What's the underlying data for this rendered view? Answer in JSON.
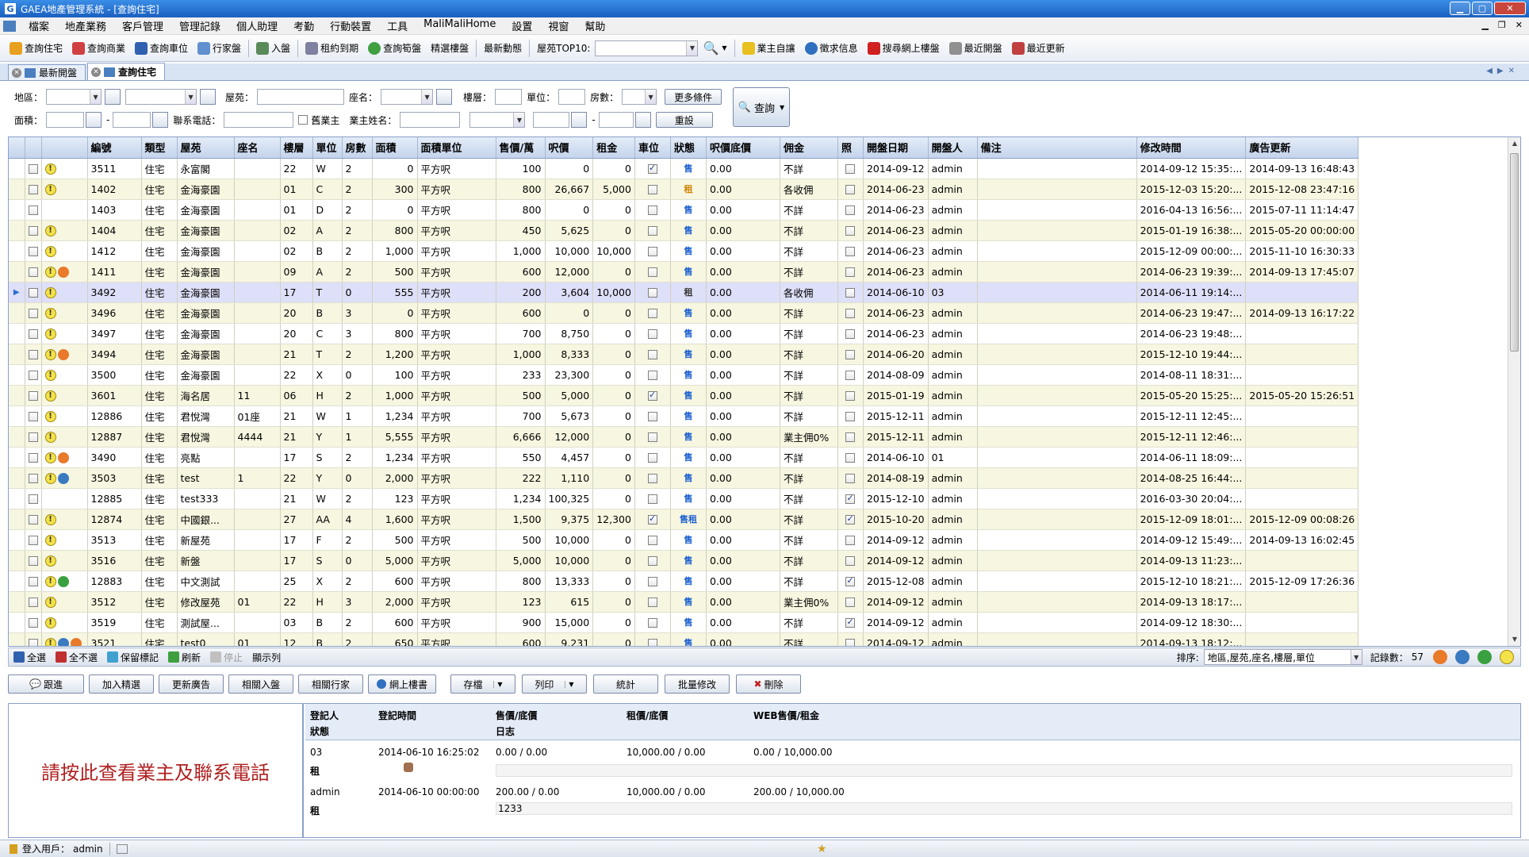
{
  "window": {
    "title": "GAEA地產管理系統 - [查詢住宅]",
    "app_letter": "G"
  },
  "menu": [
    "檔案",
    "地產業務",
    "客戶管理",
    "管理記錄",
    "個人助理",
    "考勤",
    "行動裝置",
    "工具",
    "MaliMaliHome",
    "設置",
    "視窗",
    "幫助"
  ],
  "toolbar": {
    "items": [
      "查詢住宅",
      "查詢商業",
      "查詢車位",
      "行家盤",
      "入盤",
      "租約到期",
      "查詢筍盤",
      "精選樓盤",
      "最新動態"
    ],
    "top10_label": "屋苑TOP10:",
    "right_items": [
      "業主自讓",
      "徵求信息",
      "搜尋網上樓盤",
      "最近開盤",
      "最近更新"
    ]
  },
  "tabs": [
    {
      "label": "最新開盤"
    },
    {
      "label": "查詢住宅"
    }
  ],
  "filter": {
    "area": "地區：",
    "estate": "屋苑：",
    "block": "座名：",
    "floor": "樓層：",
    "unit": "單位：",
    "rooms": "房數：",
    "more": "更多條件",
    "size": "面積：",
    "phone": "聯系電話：",
    "old_owner": "舊業主",
    "owner_name": "業主姓名：",
    "reset": "重設",
    "query": "查詢",
    "dash": "-"
  },
  "table": {
    "headers": [
      "編號",
      "類型",
      "屋苑",
      "座名",
      "樓層",
      "單位",
      "房數",
      "面積",
      "面積單位",
      "售價/萬",
      "呎價",
      "租金",
      "車位",
      "狀態",
      "呎價底價",
      "佣金",
      "照",
      "開盤日期",
      "開盤人",
      "備注",
      "修改時間",
      "廣告更新"
    ],
    "rows": [
      {
        "id": "3511",
        "type": "住宅",
        "estate": "永富閣",
        "block": "",
        "floor": "22",
        "unit": "W",
        "rooms": "2",
        "area": "0",
        "au": "平方呎",
        "price": "100",
        "psf": "0",
        "rent": "0",
        "park": true,
        "status": "售",
        "floorp": "0.00",
        "comm": "不詳",
        "photo": false,
        "open": "2014-09-12",
        "opener": "admin",
        "note": "",
        "mod": "2014-09-12 15:35:...",
        "ad": "2014-09-13 16:48:43",
        "warn": true,
        "badges": []
      },
      {
        "id": "1402",
        "type": "住宅",
        "estate": "金海豪園",
        "block": "",
        "floor": "01",
        "unit": "C",
        "rooms": "2",
        "area": "300",
        "au": "平方呎",
        "price": "800",
        "psf": "26,667",
        "rent": "5,000",
        "park": false,
        "status": "租",
        "floorp": "0.00",
        "comm": "各收佣",
        "photo": false,
        "open": "2014-06-23",
        "opener": "admin",
        "note": "",
        "mod": "2015-12-03 15:20:...",
        "ad": "2015-12-08 23:47:16",
        "warn": true,
        "badges": []
      },
      {
        "id": "1403",
        "type": "住宅",
        "estate": "金海豪園",
        "block": "",
        "floor": "01",
        "unit": "D",
        "rooms": "2",
        "area": "0",
        "au": "平方呎",
        "price": "800",
        "psf": "0",
        "rent": "0",
        "park": false,
        "status": "售",
        "floorp": "0.00",
        "comm": "不詳",
        "photo": false,
        "open": "2014-06-23",
        "opener": "admin",
        "note": "",
        "mod": "2016-04-13 16:56:...",
        "ad": "2015-07-11 11:14:47",
        "warn": false,
        "badges": []
      },
      {
        "id": "1404",
        "type": "住宅",
        "estate": "金海豪園",
        "block": "",
        "floor": "02",
        "unit": "A",
        "rooms": "2",
        "area": "800",
        "au": "平方呎",
        "price": "450",
        "psf": "5,625",
        "rent": "0",
        "park": false,
        "status": "售",
        "floorp": "0.00",
        "comm": "不詳",
        "photo": false,
        "open": "2014-06-23",
        "opener": "admin",
        "note": "",
        "mod": "2015-01-19 16:38:...",
        "ad": "2015-05-20 00:00:00",
        "warn": true,
        "badges": []
      },
      {
        "id": "1412",
        "type": "住宅",
        "estate": "金海豪園",
        "block": "",
        "floor": "02",
        "unit": "B",
        "rooms": "2",
        "area": "1,000",
        "au": "平方呎",
        "price": "1,000",
        "psf": "10,000",
        "rent": "10,000",
        "park": false,
        "status": "售",
        "floorp": "0.00",
        "comm": "不詳",
        "photo": false,
        "open": "2014-06-23",
        "opener": "admin",
        "note": "",
        "mod": "2015-12-09 00:00:...",
        "ad": "2015-11-10 16:30:33",
        "warn": true,
        "badges": []
      },
      {
        "id": "1411",
        "type": "住宅",
        "estate": "金海豪園",
        "block": "",
        "floor": "09",
        "unit": "A",
        "rooms": "2",
        "area": "500",
        "au": "平方呎",
        "price": "600",
        "psf": "12,000",
        "rent": "0",
        "park": false,
        "status": "售",
        "floorp": "0.00",
        "comm": "不詳",
        "photo": false,
        "open": "2014-06-23",
        "opener": "admin",
        "note": "",
        "mod": "2014-06-23 19:39:...",
        "ad": "2014-09-13 17:45:07",
        "warn": true,
        "badges": [
          "orange"
        ]
      },
      {
        "id": "3492",
        "type": "住宅",
        "estate": "金海豪園",
        "block": "",
        "floor": "17",
        "unit": "T",
        "rooms": "0",
        "area": "555",
        "au": "平方呎",
        "price": "200",
        "psf": "3,604",
        "rent": "10,000",
        "park": false,
        "status": "租",
        "floorp": "0.00",
        "comm": "各收佣",
        "photo": false,
        "open": "2014-06-10",
        "opener": "03",
        "note": "",
        "mod": "2014-06-11 19:14:...",
        "ad": "",
        "warn": true,
        "badges": [],
        "selected": true
      },
      {
        "id": "3496",
        "type": "住宅",
        "estate": "金海豪園",
        "block": "",
        "floor": "20",
        "unit": "B",
        "rooms": "3",
        "area": "0",
        "au": "平方呎",
        "price": "600",
        "psf": "0",
        "rent": "0",
        "park": false,
        "status": "售",
        "floorp": "0.00",
        "comm": "不詳",
        "photo": false,
        "open": "2014-06-23",
        "opener": "admin",
        "note": "",
        "mod": "2014-06-23 19:47:...",
        "ad": "2014-09-13 16:17:22",
        "warn": true,
        "badges": []
      },
      {
        "id": "3497",
        "type": "住宅",
        "estate": "金海豪園",
        "block": "",
        "floor": "20",
        "unit": "C",
        "rooms": "3",
        "area": "800",
        "au": "平方呎",
        "price": "700",
        "psf": "8,750",
        "rent": "0",
        "park": false,
        "status": "售",
        "floorp": "0.00",
        "comm": "不詳",
        "photo": false,
        "open": "2014-06-23",
        "opener": "admin",
        "note": "",
        "mod": "2014-06-23 19:48:...",
        "ad": "",
        "warn": true,
        "badges": []
      },
      {
        "id": "3494",
        "type": "住宅",
        "estate": "金海豪園",
        "block": "",
        "floor": "21",
        "unit": "T",
        "rooms": "2",
        "area": "1,200",
        "au": "平方呎",
        "price": "1,000",
        "psf": "8,333",
        "rent": "0",
        "park": false,
        "status": "售",
        "floorp": "0.00",
        "comm": "不詳",
        "photo": false,
        "open": "2014-06-20",
        "opener": "admin",
        "note": "",
        "mod": "2015-12-10 19:44:...",
        "ad": "",
        "warn": true,
        "badges": [
          "orange"
        ]
      },
      {
        "id": "3500",
        "type": "住宅",
        "estate": "金海豪園",
        "block": "",
        "floor": "22",
        "unit": "X",
        "rooms": "0",
        "area": "100",
        "au": "平方呎",
        "price": "233",
        "psf": "23,300",
        "rent": "0",
        "park": false,
        "status": "售",
        "floorp": "0.00",
        "comm": "不詳",
        "photo": false,
        "open": "2014-08-09",
        "opener": "admin",
        "note": "",
        "mod": "2014-08-11 18:31:...",
        "ad": "",
        "warn": true,
        "badges": []
      },
      {
        "id": "3601",
        "type": "住宅",
        "estate": "海名居",
        "block": "11",
        "floor": "06",
        "unit": "H",
        "rooms": "2",
        "area": "1,000",
        "au": "平方呎",
        "price": "500",
        "psf": "5,000",
        "rent": "0",
        "park": true,
        "status": "售",
        "floorp": "0.00",
        "comm": "不詳",
        "photo": false,
        "open": "2015-01-19",
        "opener": "admin",
        "note": "",
        "mod": "2015-05-20 15:25:...",
        "ad": "2015-05-20 15:26:51",
        "warn": true,
        "badges": []
      },
      {
        "id": "12886",
        "type": "住宅",
        "estate": "君悅灣",
        "block": "01座",
        "floor": "21",
        "unit": "W",
        "rooms": "1",
        "area": "1,234",
        "au": "平方呎",
        "price": "700",
        "psf": "5,673",
        "rent": "0",
        "park": false,
        "status": "售",
        "floorp": "0.00",
        "comm": "不詳",
        "photo": false,
        "open": "2015-12-11",
        "opener": "admin",
        "note": "",
        "mod": "2015-12-11 12:45:...",
        "ad": "",
        "warn": true,
        "badges": []
      },
      {
        "id": "12887",
        "type": "住宅",
        "estate": "君悅灣",
        "block": "4444",
        "floor": "21",
        "unit": "Y",
        "rooms": "1",
        "area": "5,555",
        "au": "平方呎",
        "price": "6,666",
        "psf": "12,000",
        "rent": "0",
        "park": false,
        "status": "售",
        "floorp": "0.00",
        "comm": "業主佣0%",
        "photo": false,
        "open": "2015-12-11",
        "opener": "admin",
        "note": "",
        "mod": "2015-12-11 12:46:...",
        "ad": "",
        "warn": true,
        "badges": []
      },
      {
        "id": "3490",
        "type": "住宅",
        "estate": "亮點",
        "block": "",
        "floor": "17",
        "unit": "S",
        "rooms": "2",
        "area": "1,234",
        "au": "平方呎",
        "price": "550",
        "psf": "4,457",
        "rent": "0",
        "park": false,
        "status": "售",
        "floorp": "0.00",
        "comm": "不詳",
        "photo": false,
        "open": "2014-06-10",
        "opener": "01",
        "note": "",
        "mod": "2014-06-11 18:09:...",
        "ad": "",
        "warn": true,
        "badges": [
          "orange"
        ]
      },
      {
        "id": "3503",
        "type": "住宅",
        "estate": "test",
        "block": "1",
        "floor": "22",
        "unit": "Y",
        "rooms": "0",
        "area": "2,000",
        "au": "平方呎",
        "price": "222",
        "psf": "1,110",
        "rent": "0",
        "park": false,
        "status": "售",
        "floorp": "0.00",
        "comm": "不詳",
        "photo": false,
        "open": "2014-08-19",
        "opener": "admin",
        "note": "",
        "mod": "2014-08-25 16:44:...",
        "ad": "",
        "warn": true,
        "badges": [
          "blue"
        ]
      },
      {
        "id": "12885",
        "type": "住宅",
        "estate": "test333",
        "block": "",
        "floor": "21",
        "unit": "W",
        "rooms": "2",
        "area": "123",
        "au": "平方呎",
        "price": "1,234",
        "psf": "100,325",
        "rent": "0",
        "park": false,
        "status": "售",
        "floorp": "0.00",
        "comm": "不詳",
        "photo": true,
        "open": "2015-12-10",
        "opener": "admin",
        "note": "",
        "mod": "2016-03-30 20:04:...",
        "ad": "",
        "warn": false,
        "badges": []
      },
      {
        "id": "12874",
        "type": "住宅",
        "estate": "中國銀...",
        "block": "",
        "floor": "27",
        "unit": "AA",
        "rooms": "4",
        "area": "1,600",
        "au": "平方呎",
        "price": "1,500",
        "psf": "9,375",
        "rent": "12,300",
        "park": true,
        "status": "售租",
        "floorp": "0.00",
        "comm": "不詳",
        "photo": true,
        "open": "2015-10-20",
        "opener": "admin",
        "note": "",
        "mod": "2015-12-09 18:01:...",
        "ad": "2015-12-09 00:08:26",
        "warn": true,
        "badges": []
      },
      {
        "id": "3513",
        "type": "住宅",
        "estate": "新屋苑",
        "block": "",
        "floor": "17",
        "unit": "F",
        "rooms": "2",
        "area": "500",
        "au": "平方呎",
        "price": "500",
        "psf": "10,000",
        "rent": "0",
        "park": false,
        "status": "售",
        "floorp": "0.00",
        "comm": "不詳",
        "photo": false,
        "open": "2014-09-12",
        "opener": "admin",
        "note": "",
        "mod": "2014-09-12 15:49:...",
        "ad": "2014-09-13 16:02:45",
        "warn": true,
        "badges": []
      },
      {
        "id": "3516",
        "type": "住宅",
        "estate": "新盤",
        "block": "",
        "floor": "17",
        "unit": "S",
        "rooms": "0",
        "area": "5,000",
        "au": "平方呎",
        "price": "5,000",
        "psf": "10,000",
        "rent": "0",
        "park": false,
        "status": "售",
        "floorp": "0.00",
        "comm": "不詳",
        "photo": false,
        "open": "2014-09-12",
        "opener": "admin",
        "note": "",
        "mod": "2014-09-13 11:23:...",
        "ad": "",
        "warn": true,
        "badges": []
      },
      {
        "id": "12883",
        "type": "住宅",
        "estate": "中文測試",
        "block": "",
        "floor": "25",
        "unit": "X",
        "rooms": "2",
        "area": "600",
        "au": "平方呎",
        "price": "800",
        "psf": "13,333",
        "rent": "0",
        "park": false,
        "status": "售",
        "floorp": "0.00",
        "comm": "不詳",
        "photo": true,
        "open": "2015-12-08",
        "opener": "admin",
        "note": "",
        "mod": "2015-12-10 18:21:...",
        "ad": "2015-12-09 17:26:36",
        "warn": true,
        "badges": [
          "green"
        ]
      },
      {
        "id": "3512",
        "type": "住宅",
        "estate": "修改屋苑",
        "block": "01",
        "floor": "22",
        "unit": "H",
        "rooms": "3",
        "area": "2,000",
        "au": "平方呎",
        "price": "123",
        "psf": "615",
        "rent": "0",
        "park": false,
        "status": "售",
        "floorp": "0.00",
        "comm": "業主佣0%",
        "photo": false,
        "open": "2014-09-12",
        "opener": "admin",
        "note": "",
        "mod": "2014-09-13 18:17:...",
        "ad": "",
        "warn": true,
        "badges": []
      },
      {
        "id": "3519",
        "type": "住宅",
        "estate": "測試屋...",
        "block": "",
        "floor": "03",
        "unit": "B",
        "rooms": "2",
        "area": "600",
        "au": "平方呎",
        "price": "900",
        "psf": "15,000",
        "rent": "0",
        "park": false,
        "status": "售",
        "floorp": "0.00",
        "comm": "不詳",
        "photo": true,
        "open": "2014-09-12",
        "opener": "admin",
        "note": "",
        "mod": "2014-09-12 18:30:...",
        "ad": "",
        "warn": true,
        "badges": []
      },
      {
        "id": "3521",
        "type": "住宅",
        "estate": "test0",
        "block": "01",
        "floor": "12",
        "unit": "B",
        "rooms": "2",
        "area": "650",
        "au": "平方呎",
        "price": "600",
        "psf": "9,231",
        "rent": "0",
        "park": false,
        "status": "售",
        "floorp": "0.00",
        "comm": "不詳",
        "photo": false,
        "open": "2014-09-12",
        "opener": "admin",
        "note": "",
        "mod": "2014-09-13 18:12:...",
        "ad": "",
        "warn": true,
        "badges": [
          "blue",
          "orange"
        ]
      }
    ]
  },
  "gridbar": {
    "select_all": "全選",
    "select_none": "全不選",
    "keep_mark": "保留標記",
    "refresh": "刷新",
    "stop": "停止",
    "show_cols": "顯示列",
    "sort_label": "排序:",
    "sort_value": "地區,屋苑,座名,樓層,單位",
    "record_label": "記錄數：",
    "record_count": "57"
  },
  "actions": {
    "follow": "跟進",
    "add_featured": "加入精選",
    "update_ad": "更新廣告",
    "related_entry": "相關入盤",
    "related_agent": "相關行家",
    "online_listing": "網上樓書",
    "save": "存檔",
    "print": "列印",
    "stats": "統計",
    "batch_edit": "批量修改",
    "delete": "刪除"
  },
  "detail": {
    "notice": "請按此查看業主及聯系電話",
    "headers": {
      "registrant": "登記人",
      "status": "狀態",
      "reg_time": "登記時間",
      "sale": "售價/底價",
      "log": "日志",
      "rent": "租價/底價",
      "web": "WEB售價/租金"
    },
    "rows": [
      {
        "registrant": "03",
        "reg_time": "2014-06-10 16:25:02",
        "sale": "0.00 / 0.00",
        "rent": "10,000.00 / 0.00",
        "web": "0.00 / 10,000.00",
        "status": "租",
        "log": ""
      },
      {
        "registrant": "admin",
        "reg_time": "2014-06-10 00:00:00",
        "sale": "200.00 / 0.00",
        "rent": "10,000.00 / 0.00",
        "web": "200.00 / 10,000.00",
        "status": "租",
        "log": "1233"
      }
    ]
  },
  "statusbar": {
    "user_label": "登入用戶：",
    "user": "admin"
  }
}
